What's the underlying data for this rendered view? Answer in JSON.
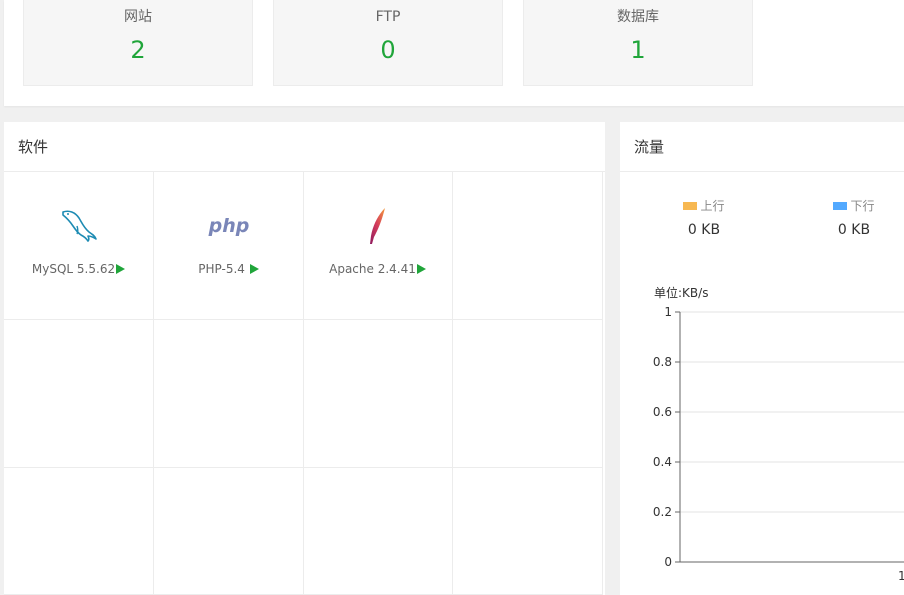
{
  "stats": [
    {
      "label": "网站",
      "value": "2"
    },
    {
      "label": "FTP",
      "value": "0"
    },
    {
      "label": "数据库",
      "value": "1"
    }
  ],
  "software": {
    "title": "软件",
    "items": [
      {
        "name": "MySQL 5.5.62",
        "icon": "mysql-dolphin-icon"
      },
      {
        "name": "PHP-5.4",
        "icon": "php-logo-icon"
      },
      {
        "name": "Apache 2.4.41",
        "icon": "apache-feather-icon"
      }
    ]
  },
  "traffic": {
    "title": "流量",
    "up_label": "上行",
    "up_value": "0 KB",
    "down_label": "下行",
    "down_value": "0 KB",
    "unit": "单位:KB/s",
    "colors": {
      "up": "#f7b851",
      "down": "#52a9ff"
    }
  },
  "chart_data": {
    "type": "line",
    "ylabel": "单位:KB/s",
    "ylim": [
      0,
      1
    ],
    "yticks": [
      "0",
      "0.2",
      "0.4",
      "0.6",
      "0.8",
      "1"
    ],
    "xticks": [
      "1"
    ],
    "series": []
  }
}
